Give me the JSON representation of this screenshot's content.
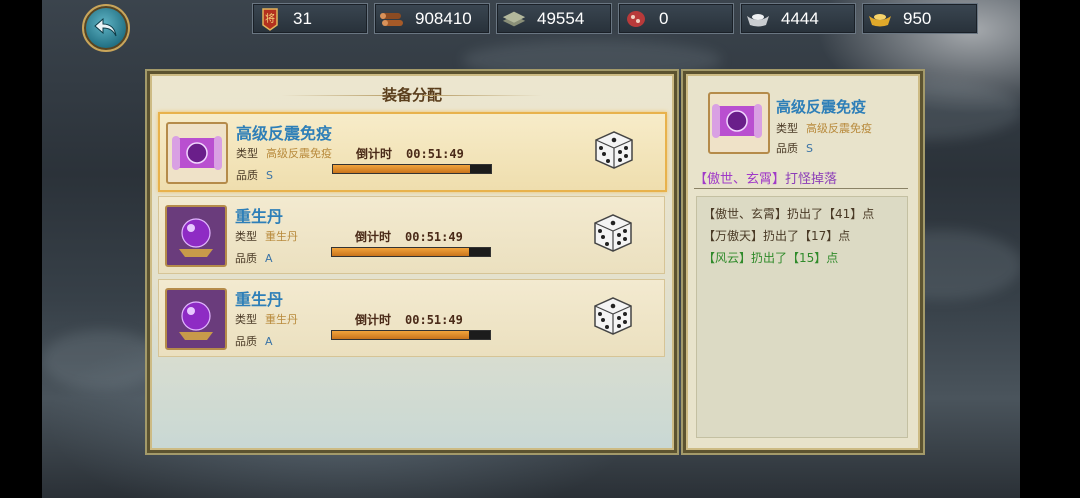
{
  "resources": [
    {
      "icon": "rank-banner-icon",
      "value": "31"
    },
    {
      "icon": "wood-logs-icon",
      "value": "908410"
    },
    {
      "icon": "stone-bricks-icon",
      "value": "49554"
    },
    {
      "icon": "meat-icon",
      "value": "0"
    },
    {
      "icon": "silver-ingot-icon",
      "value": "4444"
    },
    {
      "icon": "gold-ingot-icon",
      "value": "950"
    }
  ],
  "left_panel": {
    "title": "装备分配",
    "items": [
      {
        "name": "高级反震免疫",
        "type_label": "类型",
        "type_value": "高级反震免疫",
        "quality_label": "品质",
        "quality_value": "S",
        "timer_label": "倒计时",
        "timer_value": "00:51:49",
        "progress": 0.87,
        "icon": "purple-scroll-icon",
        "selected": true
      },
      {
        "name": "重生丹",
        "type_label": "类型",
        "type_value": "重生丹",
        "quality_label": "品质",
        "quality_value": "A",
        "timer_label": "倒计时",
        "timer_value": "00:51:49",
        "progress": 0.87,
        "icon": "purple-orb-icon",
        "selected": false
      },
      {
        "name": "重生丹",
        "type_label": "类型",
        "type_value": "重生丹",
        "quality_label": "品质",
        "quality_value": "A",
        "timer_label": "倒计时",
        "timer_value": "00:51:49",
        "progress": 0.87,
        "icon": "purple-orb-icon",
        "selected": false
      }
    ]
  },
  "right_panel": {
    "name": "高级反震免疫",
    "type_label": "类型",
    "type_value": "高级反震免疫",
    "quality_label": "品质",
    "quality_value": "S",
    "drop_source": "【傲世、玄霄】",
    "drop_text": "打怪掉落",
    "log": [
      {
        "text": "【傲世、玄霄】扔出了【41】点",
        "color": "#4a3a26"
      },
      {
        "text": "【万傲天】扔出了【17】点",
        "color": "#4a3a26"
      },
      {
        "text": "【风云】扔出了【15】点",
        "color": "#2f8a2a"
      }
    ]
  },
  "colors": {
    "accent": "#2e7fb8",
    "frame": "#cdbb84",
    "progress": "#f2a43c"
  }
}
